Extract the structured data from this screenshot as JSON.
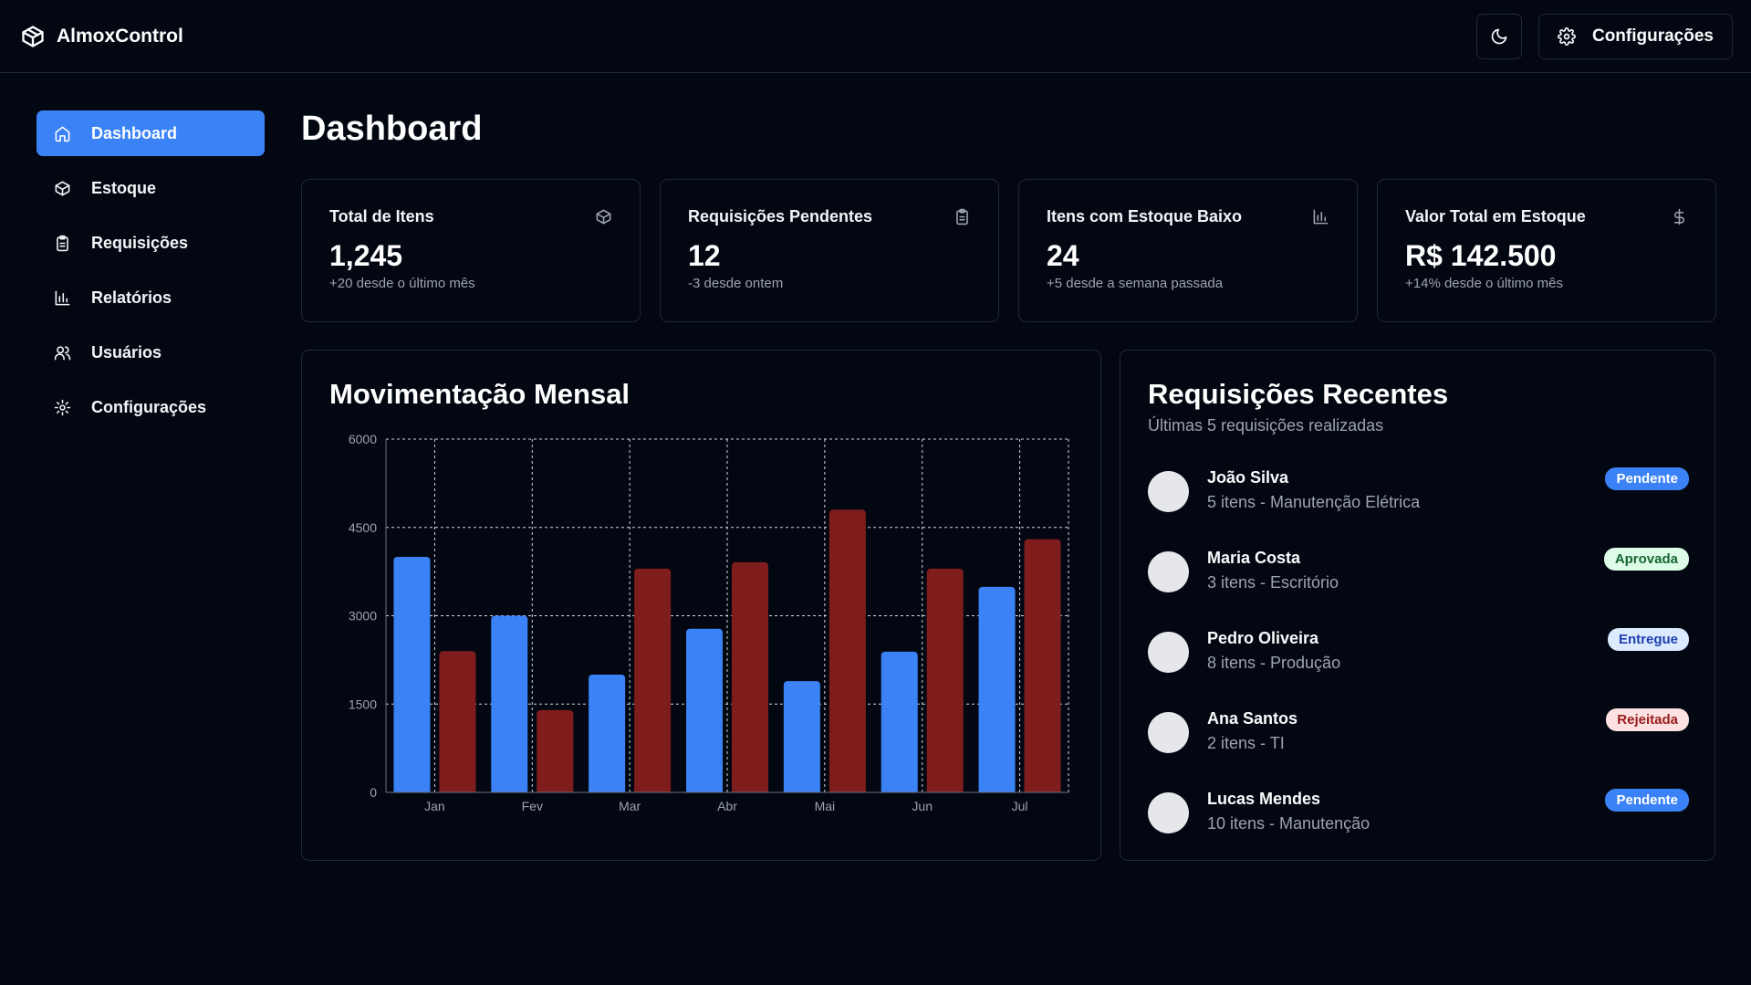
{
  "app": {
    "title": "AlmoxControl",
    "settings_label": "Configurações"
  },
  "sidebar": {
    "items": [
      {
        "label": "Dashboard",
        "icon": "home-icon",
        "active": true
      },
      {
        "label": "Estoque",
        "icon": "package-icon",
        "active": false
      },
      {
        "label": "Requisições",
        "icon": "clipboard-icon",
        "active": false
      },
      {
        "label": "Relatórios",
        "icon": "bar-chart-icon",
        "active": false
      },
      {
        "label": "Usuários",
        "icon": "users-icon",
        "active": false
      },
      {
        "label": "Configurações",
        "icon": "gear-icon",
        "active": false
      }
    ]
  },
  "page": {
    "title": "Dashboard"
  },
  "stats": [
    {
      "title": "Total de Itens",
      "value": "1,245",
      "sub": "+20 desde o último mês",
      "icon": "package-icon"
    },
    {
      "title": "Requisições Pendentes",
      "value": "12",
      "sub": "-3 desde ontem",
      "icon": "clipboard-icon"
    },
    {
      "title": "Itens com Estoque Baixo",
      "value": "24",
      "sub": "+5 desde a semana passada",
      "icon": "bar-chart-icon"
    },
    {
      "title": "Valor Total em Estoque",
      "value": "R$ 142.500",
      "sub": "+14% desde o último mês",
      "icon": "dollar-icon"
    }
  ],
  "chart_card": {
    "title": "Movimentação Mensal"
  },
  "chart_data": {
    "type": "bar",
    "categories": [
      "Jan",
      "Fev",
      "Mar",
      "Abr",
      "Mai",
      "Jun",
      "Jul"
    ],
    "series": [
      {
        "values": [
          4000,
          3000,
          2000,
          2780,
          1890,
          2390,
          3490
        ],
        "color": "#3b82f6"
      },
      {
        "values": [
          2400,
          1398,
          3800,
          3908,
          4800,
          3800,
          4300
        ],
        "color": "#7f1d1d"
      }
    ],
    "yticks": [
      "0",
      "1500",
      "3000",
      "4500",
      "6000"
    ],
    "ylim": [
      0,
      6000
    ],
    "grid": true,
    "legend": "none"
  },
  "requests": {
    "title": "Requisições Recentes",
    "subtitle": "Últimas 5 requisições realizadas",
    "items": [
      {
        "name": "João Silva",
        "desc": "5 itens - Manutenção Elétrica",
        "status": "Pendente",
        "bg": "#3b82f6",
        "fg": "#ffffff"
      },
      {
        "name": "Maria Costa",
        "desc": "3 itens - Escritório",
        "status": "Aprovada",
        "bg": "#dcfce7",
        "fg": "#166534"
      },
      {
        "name": "Pedro Oliveira",
        "desc": "8 itens - Produção",
        "status": "Entregue",
        "bg": "#dbeafe",
        "fg": "#1e40af"
      },
      {
        "name": "Ana Santos",
        "desc": "2 itens - TI",
        "status": "Rejeitada",
        "bg": "#fee2e2",
        "fg": "#991b1b"
      },
      {
        "name": "Lucas Mendes",
        "desc": "10 itens - Manutenção",
        "status": "Pendente",
        "bg": "#3b82f6",
        "fg": "#ffffff"
      }
    ]
  }
}
